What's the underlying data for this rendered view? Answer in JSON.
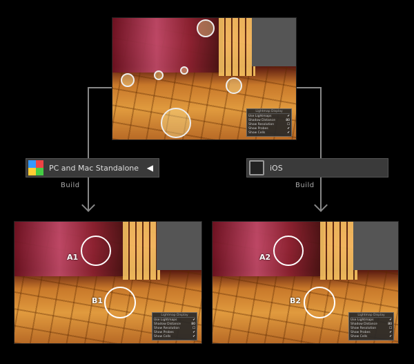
{
  "panel": {
    "title": "Lightmap Display",
    "rows": [
      {
        "label": "Use Lightmaps",
        "value": "✔"
      },
      {
        "label": "Shadow Distance",
        "value": "80"
      },
      {
        "label": "Show Resolution",
        "value": "☐"
      },
      {
        "label": "Show Probes",
        "value": "✔"
      },
      {
        "label": "Show Cells",
        "value": "✔"
      }
    ]
  },
  "platforms": [
    {
      "label": "PC and Mac Standalone",
      "icon": "windows-mac-icon",
      "badge": "unity-icon"
    },
    {
      "label": "iOS",
      "icon": "ipad-icon"
    }
  ],
  "build_label": "Build",
  "markers": {
    "a1": "A1",
    "b1": "B1",
    "a2": "A2",
    "b2": "B2"
  }
}
